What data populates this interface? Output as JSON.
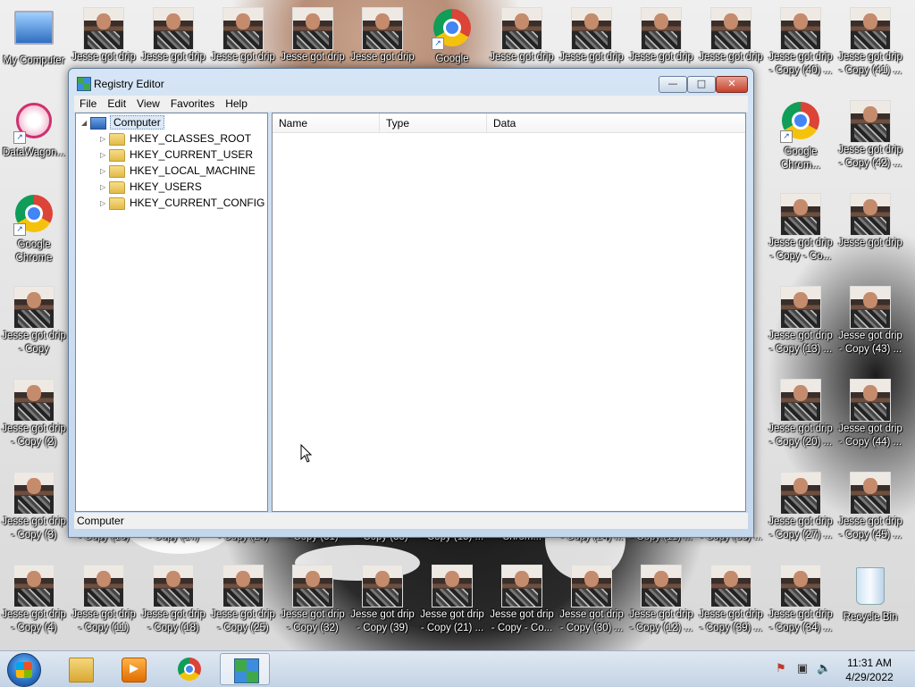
{
  "desktop": {
    "icons_top_row": [
      {
        "label": "My Computer",
        "type": "computer"
      },
      {
        "label": "Jesse got drip",
        "type": "photo"
      },
      {
        "label": "Jesse got drip",
        "type": "photo"
      },
      {
        "label": "Jesse got drip",
        "type": "photo"
      },
      {
        "label": "Jesse got drip",
        "type": "photo"
      },
      {
        "label": "Jesse got drip",
        "type": "photo"
      },
      {
        "label": "Google",
        "type": "chrome"
      },
      {
        "label": "Jesse got drip",
        "type": "photo"
      },
      {
        "label": "Jesse got drip",
        "type": "photo"
      },
      {
        "label": "Jesse got drip",
        "type": "photo"
      },
      {
        "label": "Jesse got drip",
        "type": "photo"
      },
      {
        "label": "Jesse got drip - Copy (40) ...",
        "type": "photo"
      },
      {
        "label": "Jesse got drip - Copy (41) ...",
        "type": "photo"
      }
    ],
    "icons_left_col": [
      {
        "label": "DataWagon...",
        "type": "datawagon"
      },
      {
        "label": "Google Chrome",
        "type": "chrome"
      },
      {
        "label": "Jesse got drip - Copy",
        "type": "photo"
      },
      {
        "label": "Jesse got drip - Copy (2)",
        "type": "photo"
      },
      {
        "label": "Jesse got drip - Copy (3)",
        "type": "photo"
      }
    ],
    "icons_right_col1": [
      {
        "label": "Google Chrom...",
        "type": "chrome"
      },
      {
        "label": "Jesse got drip - Copy - Co...",
        "type": "photo"
      },
      {
        "label": "Jesse got drip - Copy (13) ...",
        "type": "photo"
      },
      {
        "label": "Jesse got drip - Copy (20) ...",
        "type": "photo"
      },
      {
        "label": "Jesse got drip - Copy (27) ...",
        "type": "photo"
      }
    ],
    "icons_right_col2": [
      {
        "label": "Jesse got drip - Copy (42) ...",
        "type": "photo"
      },
      {
        "label": "Jesse got drip",
        "type": "photo"
      },
      {
        "label": "Jesse got drip - Copy (43) ...",
        "type": "photo"
      },
      {
        "label": "Jesse got drip - Copy (44) ...",
        "type": "photo"
      },
      {
        "label": "Jesse got drip - Copy (45) ...",
        "type": "photo"
      }
    ],
    "partial_row_labels": [
      "- Copy (10)",
      "- Copy (17)",
      "- Copy (24)",
      "- Copy (31)",
      "- Copy (38)",
      "- Copy (15) ...",
      "Chrom...",
      "- Copy (24) ...",
      "- Copy (11) ...",
      "- Copy (35) ..."
    ],
    "bottom_row": [
      {
        "label": "Jesse got drip - Copy (4)",
        "type": "photo"
      },
      {
        "label": "Jesse got drip - Copy (11)",
        "type": "photo"
      },
      {
        "label": "Jesse got drip - Copy (18)",
        "type": "photo"
      },
      {
        "label": "Jesse got drip - Copy (25)",
        "type": "photo"
      },
      {
        "label": "Jesse got drip - Copy (32)",
        "type": "photo"
      },
      {
        "label": "Jesse got drip - Copy (39)",
        "type": "photo"
      },
      {
        "label": "Jesse got drip - Copy (21) ...",
        "type": "photo"
      },
      {
        "label": "Jesse got drip - Copy - Co...",
        "type": "photo"
      },
      {
        "label": "Jesse got drip - Copy (30) ...",
        "type": "photo"
      },
      {
        "label": "Jesse got drip - Copy (12) ...",
        "type": "photo"
      },
      {
        "label": "Jesse got drip - Copy (39) ...",
        "type": "photo"
      },
      {
        "label": "Jesse got drip - Copy (34) ...",
        "type": "photo"
      },
      {
        "label": "Recycle Bin",
        "type": "recycle"
      }
    ]
  },
  "window": {
    "title": "Registry Editor",
    "controls": {
      "minimize": "—",
      "maximize": "□",
      "close": "✕"
    },
    "menu": [
      "File",
      "Edit",
      "View",
      "Favorites",
      "Help"
    ],
    "tree": {
      "root": "Computer",
      "children": [
        "HKEY_CLASSES_ROOT",
        "HKEY_CURRENT_USER",
        "HKEY_LOCAL_MACHINE",
        "HKEY_USERS",
        "HKEY_CURRENT_CONFIG"
      ]
    },
    "columns": [
      "Name",
      "Type",
      "Data"
    ],
    "status": "Computer"
  },
  "taskbar": {
    "apps": [
      "windows-explorer",
      "media-player",
      "google-chrome",
      "registry-editor"
    ],
    "active_app": "registry-editor",
    "clock": {
      "time": "11:31 AM",
      "date": "4/29/2022"
    }
  }
}
